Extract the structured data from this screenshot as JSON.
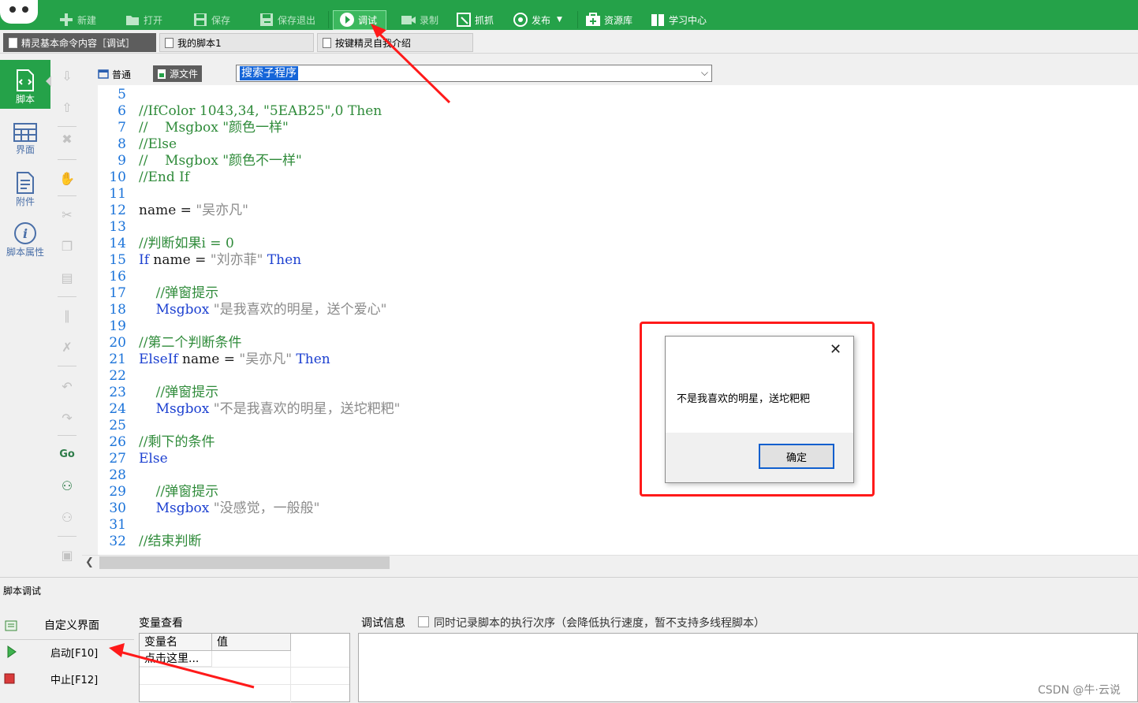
{
  "toolbar": {
    "new": "新建",
    "open": "打开",
    "save": "保存",
    "save_exit": "保存退出",
    "debug": "调试",
    "record": "录制",
    "capture": "抓抓",
    "publish": "发布",
    "resource": "资源库",
    "learning": "学习中心"
  },
  "tabs": [
    {
      "label": "精灵基本命令内容［调试］"
    },
    {
      "label": "我的脚本1"
    },
    {
      "label": "按键精灵自我介绍"
    }
  ],
  "leftnav": {
    "script": "脚本",
    "ui": "界面",
    "attachment": "附件",
    "properties": "脚本属性"
  },
  "editor_head": {
    "mode_normal": "普通",
    "mode_source": "源文件",
    "search_placeholder": "搜索子程序"
  },
  "code_lines": [
    {
      "n": "5",
      "text": ""
    },
    {
      "n": "6",
      "text": "//IfColor 1043,34, \"5EAB25\",0 Then"
    },
    {
      "n": "7",
      "text": "//    Msgbox \"颜色一样\""
    },
    {
      "n": "8",
      "text": "//Else"
    },
    {
      "n": "9",
      "text": "//    Msgbox \"颜色不一样\""
    },
    {
      "n": "10",
      "text": "//End If"
    },
    {
      "n": "11",
      "text": ""
    },
    {
      "n": "12",
      "text": "name = \"吴亦凡\""
    },
    {
      "n": "13",
      "text": ""
    },
    {
      "n": "14",
      "text": "//判断如果i = 0"
    },
    {
      "n": "15",
      "text": "If name = \"刘亦菲\" Then"
    },
    {
      "n": "16",
      "text": ""
    },
    {
      "n": "17",
      "text": "    //弹窗提示"
    },
    {
      "n": "18",
      "text": "    Msgbox \"是我喜欢的明星，送个爱心\""
    },
    {
      "n": "19",
      "text": ""
    },
    {
      "n": "20",
      "text": "//第二个判断条件"
    },
    {
      "n": "21",
      "text": "ElseIf name = \"吴亦凡\" Then"
    },
    {
      "n": "22",
      "text": ""
    },
    {
      "n": "23",
      "text": "    //弹窗提示"
    },
    {
      "n": "24",
      "text": "    Msgbox \"不是我喜欢的明星，送坨粑粑\""
    },
    {
      "n": "25",
      "text": ""
    },
    {
      "n": "26",
      "text": "//剩下的条件"
    },
    {
      "n": "27",
      "text": "Else"
    },
    {
      "n": "28",
      "text": ""
    },
    {
      "n": "29",
      "text": "    //弹窗提示"
    },
    {
      "n": "30",
      "text": "    Msgbox \"没感觉，一般般\""
    },
    {
      "n": "31",
      "text": ""
    },
    {
      "n": "32",
      "text": "//结束判断"
    }
  ],
  "msgbox": {
    "text": "不是我喜欢的明星，送坨粑粑",
    "ok": "确定",
    "close": "✕"
  },
  "debug": {
    "title": "脚本调试",
    "custom_ui": "自定义界面",
    "start": "启动[F10]",
    "stop": "中止[F12]",
    "var_title": "变量查看",
    "var_col_name": "变量名",
    "var_col_value": "值",
    "var_row_hint": "点击这里...",
    "info_title": "调试信息",
    "info_check_label": "同时记录脚本的执行次序（会降低执行速度，暂不支持多线程脚本）"
  },
  "watermark": "CSDN @牛·云说",
  "colors": {
    "brand_green": "#25a249",
    "annotation_red": "#ff1a1a",
    "keyword_blue": "#1b3fd0",
    "comment_green": "#2f8b3a"
  }
}
